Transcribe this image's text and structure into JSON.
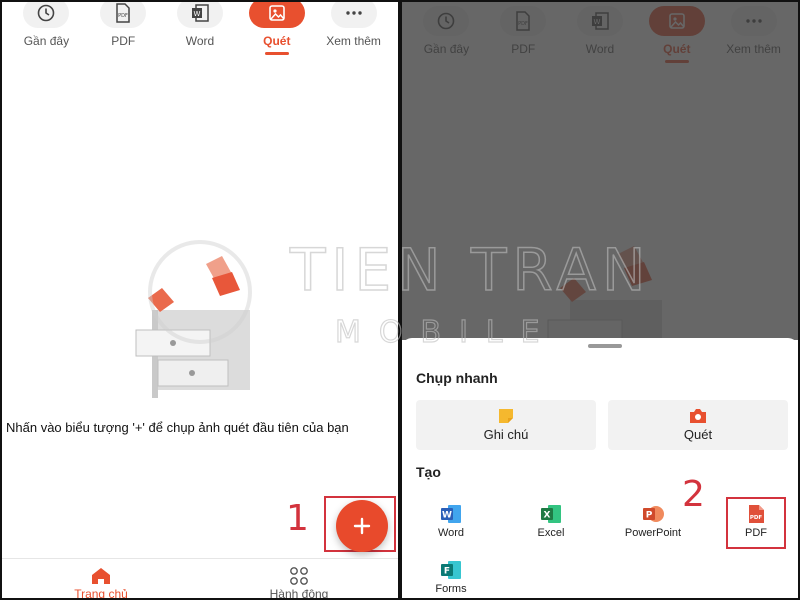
{
  "tabs": [
    {
      "label": "Gần đây",
      "icon": "clock-icon"
    },
    {
      "label": "PDF",
      "icon": "pdf-file-icon"
    },
    {
      "label": "Word",
      "icon": "word-file-icon"
    },
    {
      "label": "Quét",
      "icon": "image-scan-icon",
      "active": true
    },
    {
      "label": "Xem thêm",
      "icon": "more-icon"
    }
  ],
  "left": {
    "empty_message": "Nhấn vào biểu tượng '+' để chụp ảnh quét đầu tiên của bạn",
    "fab_label": "+",
    "step": "1"
  },
  "bottom_nav": [
    {
      "label": "Trang chủ",
      "icon": "home-icon",
      "active": true
    },
    {
      "label": "Hành động",
      "icon": "actions-grid-icon"
    }
  ],
  "watermark": {
    "line1": "TIEN TRAN",
    "line2": "MOBILE"
  },
  "sheet": {
    "quick_title": "Chụp nhanh",
    "quick": [
      {
        "label": "Ghi chú",
        "icon": "note-icon",
        "color": "#f5b82e"
      },
      {
        "label": "Quét",
        "icon": "camera-icon",
        "color": "#e8502f"
      }
    ],
    "create_title": "Tạo",
    "create": [
      {
        "label": "Word",
        "icon": "word-icon",
        "letter": "W",
        "color": "#2b5fb8"
      },
      {
        "label": "Excel",
        "icon": "excel-icon",
        "letter": "X",
        "color": "#1f7a44"
      },
      {
        "label": "PowerPoint",
        "icon": "powerpoint-icon",
        "letter": "P",
        "color": "#d04a2b"
      },
      {
        "label": "PDF",
        "icon": "pdf-icon",
        "letter": "PDF",
        "color": "#e0503a"
      },
      {
        "label": "Forms",
        "icon": "forms-icon",
        "letter": "F",
        "color": "#0b7a75"
      }
    ],
    "step": "2"
  },
  "colors": {
    "accent": "#e8502f",
    "highlight": "#d3333d"
  }
}
